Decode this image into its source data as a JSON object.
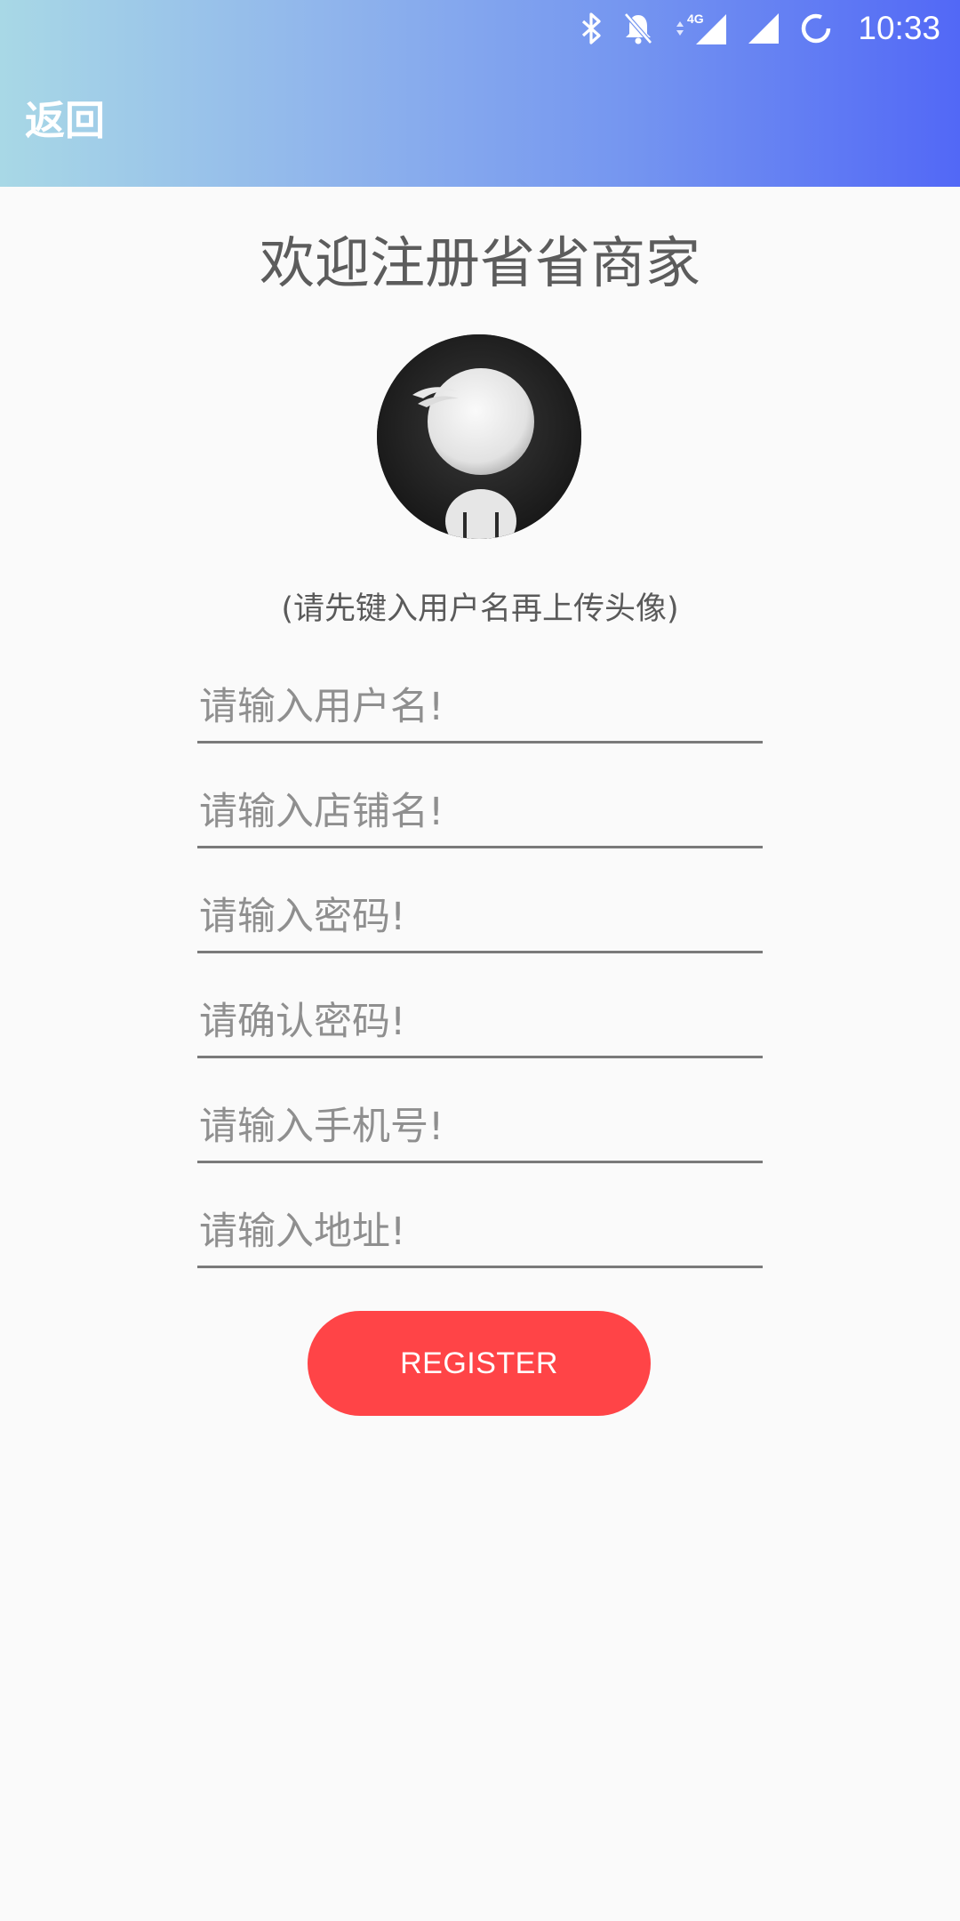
{
  "status_bar": {
    "time": "10:33",
    "network": "4G",
    "icons": [
      "bluetooth-icon",
      "notifications-off-icon",
      "data-arrows-icon",
      "signal-icon",
      "signal-icon",
      "loading-icon"
    ]
  },
  "app_bar": {
    "back_label": "返回",
    "gradient": [
      "#a8d8e6",
      "#5268f6"
    ]
  },
  "page": {
    "title": "欢迎注册省省商家",
    "avatar_hint": "(请先键入用户名再上传头像)"
  },
  "form": {
    "username_placeholder": "请输入用户名!",
    "shopname_placeholder": "请输入店铺名!",
    "password_placeholder": "请输入密码!",
    "confirm_password_placeholder": "请确认密码!",
    "phone_placeholder": "请输入手机号!",
    "address_placeholder": "请输入地址!"
  },
  "register": {
    "label": "REGISTER",
    "color": "#ff4447"
  }
}
